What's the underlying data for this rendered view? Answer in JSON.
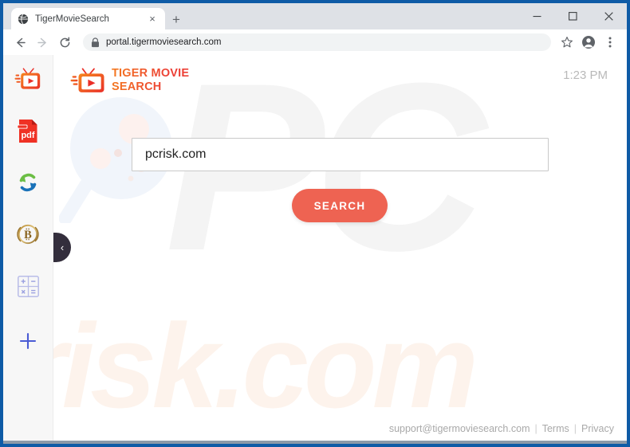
{
  "browser": {
    "tab": {
      "title": "TigerMovieSearch",
      "favicon": "globe-icon",
      "close_label": "×"
    },
    "new_tab_label": "+",
    "window_controls": {
      "minimize": "–",
      "maximize": "□",
      "close": "✕"
    },
    "nav": {
      "back": "←",
      "forward": "→",
      "reload": "↻"
    },
    "omnibox": {
      "url": "portal.tigermoviesearch.com",
      "lock": "lock-icon"
    },
    "toolbar_right": {
      "bookmark": "star-icon",
      "profile": "profile-icon",
      "menu": "three-dot-menu-icon"
    }
  },
  "page": {
    "logo": {
      "text": "TIGER MOVIE\nSEARCH",
      "mark": "tv-play-icon"
    },
    "clock": "1:23 PM",
    "search": {
      "value": "pcrisk.com",
      "placeholder": "",
      "button_label": "SEARCH"
    },
    "watermarks": {
      "big": "PC",
      "small": "risk.com",
      "magnifier": "magnifier-watermark"
    },
    "footer": {
      "email": "support@tigermoviesearch.com",
      "sep1": "|",
      "terms": "Terms",
      "sep2": "|",
      "privacy": "Privacy"
    },
    "sidebar": {
      "collapse_label": "‹",
      "items": [
        {
          "name": "tv-movie-icon",
          "label": "Tiger Movie Search"
        },
        {
          "name": "pdf-icon",
          "label": "pdf"
        },
        {
          "name": "converter-arrows-icon",
          "label": "Converter"
        },
        {
          "name": "bitcoin-icon",
          "label": "B"
        },
        {
          "name": "calculator-icon",
          "label": "Calculator"
        },
        {
          "name": "plus-icon",
          "label": "+"
        }
      ]
    }
  },
  "colors": {
    "accent": "#ee6352",
    "logo_orange": "#f47b20",
    "logo_red": "#ec3f35",
    "browser_frame": "#0e5ba6",
    "titlebar": "#dee1e6",
    "sidebar_bg": "#f7f7f7",
    "handle": "#332e3c"
  }
}
